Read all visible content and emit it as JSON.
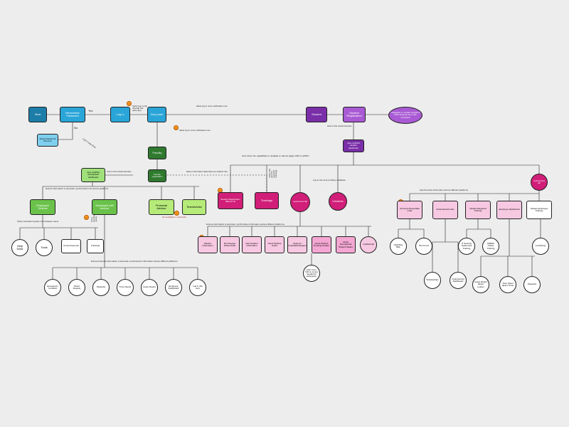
{
  "flow": {
    "start": "Start",
    "remember_pw": "Remember Password",
    "login": "Log in",
    "duo": "Duo push",
    "student": "Student",
    "student_registration_portal": "Student Registration",
    "navigate_programs": "Navigates to outside programs while keeping log in info consistent",
    "view_student_dash": "view myWSU student dashboard",
    "faculty": "Faculty",
    "faculty_reg": "Faculty registration",
    "view_faculty_dash": "view myWSU faculty/staff dashboard",
    "reset_pw": "Reset Password/ Recover",
    "emp_toolbox": "Employee Toolbox",
    "ess": "Employee self service",
    "fin_advisor": "Financial Advisor",
    "teamadvise": "TeamAdvise",
    "help_desk": "Help Desk",
    "tools": "Tools",
    "announcements": "Announcements",
    "trainings_small": "Trainings",
    "emergency_contacts": "Emergency Contacts",
    "direct_deposit": "Direct Deposit",
    "paystubs": "Paystubs",
    "time_sheets": "Time sheets",
    "leave_report": "Leave Report",
    "employee_dashboard": "Employee Dashboard",
    "student_reg_banner": "Student Registration (Banner 9)",
    "trainings": "Trainings",
    "myconnect": "myConnect tab",
    "libraries": "Libraries",
    "myfinances": "myFinances tab",
    "student_info": "Student Information",
    "degree_works": "Run Degree Works Audit",
    "new_student_info": "New Student Information",
    "check_holds": "check Student Holds",
    "apply_grad": "Apply for Graduation/Degree",
    "check_pending_grades": "check Student Pending Grades",
    "check_intl": "check International Student Status",
    "mywebmail": "myWebmail",
    "ar_links": "Accounts Receivable Links",
    "fa_links": "Financial Aid Links",
    "student_training": "Student Required Training",
    "emp_dash": "Employee Dashboard",
    "student_emp_training": "Student Employee Training",
    "view_pay_bills": "View/Pay Bills",
    "tax_forms": "Tax Forms",
    "it_sec": "IT Security Awareness Training",
    "ferpa": "FERPA Online Training",
    "leave_report_enter": "Leave Report (Enter Leave)",
    "time_sheet_enter": "Time Sheet (Enter Time)",
    "paystubs2": "Paystubs",
    "mytraining": "myTraining",
    "scholarships": "Scholarships",
    "fa_dash": "Financial Aid Dashboard",
    "other_conn": "other conn. OR no conns needed for subsystem"
  },
  "labels": {
    "yes": "Yes",
    "no": "No",
    "call_it": "Call IT help desk",
    "verify_3rd": "Verify log in info through 3rd party app",
    "allow_login": "Allow log in once verification met",
    "allow_login2": "Allow log in once verification met",
    "first_visual_s": "User's first visual stimulus",
    "first_visual_f": "User's first visual stimulus",
    "nav_pages": "User Given the capabilities to navigate to various pages within myWSU",
    "same_info": "Same information data base as student info",
    "log_lib": "Log in info sent to library database",
    "verify_sent_training": "Verify info sent for required trainings",
    "sync_platforms": "Ensure information is accurate; synchronizes info across platforms",
    "sync_platforms2": "Ensure information is accurate; synchronizes information across different platforms",
    "sync_fin": "Ensure financial information is accurate; synchronizes information across different platforms",
    "sync_platforms3": "Synchronizes information across different platforms",
    "verify_consistent": "Verify consistent system info between users",
    "not_available": "Not available to all faculty",
    "put_warning": "Put a warning notice",
    "checks_trainings": "checks trainings",
    "retrieve_personal": "Retrieve Personal Info",
    "fin_info_sent": "Financial Info sent/needs verification",
    "fin_info_used": "Financial Info needs used",
    "tracks_hours": "Tracks hours/Pay info",
    "checks_schedule": "Checks current schedule",
    "login_info": "Log in info sent"
  },
  "colors": {
    "blue": "#2aa5d8",
    "blue_d": "#1c7da8",
    "purple": "#7a2ea8",
    "purple_l": "#a95ad4",
    "green_d": "#2f7a2f",
    "green": "#6ac24a",
    "green_l": "#9fe07a",
    "lime": "#b6eb7a",
    "magenta": "#d11e78",
    "pink": "#f3a7d2",
    "pink_l": "#f7c8e2",
    "white": "#ffffff",
    "grey": "#cfcfcf"
  }
}
